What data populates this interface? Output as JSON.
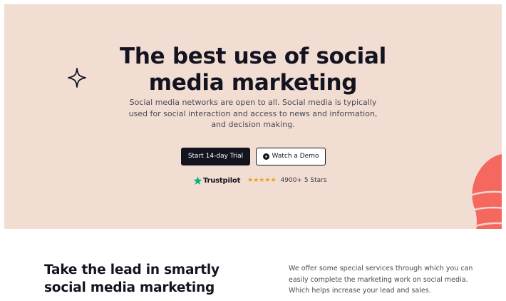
{
  "hero": {
    "title_lines": [
      "The best use of social",
      "media marketing"
    ],
    "description_lines": [
      "Social media networks are open to all. Social media is typically",
      "used for social interaction and access to news and information,",
      "and decision making."
    ],
    "primary_button": "Start 14-day Trial",
    "secondary_button": "Watch a Demo",
    "trustpilot_label": "Trustpilot",
    "stars": "★★★★★",
    "rating_text": "4900+ 5 Stars",
    "star_rating": 5
  },
  "lead": {
    "title_lines": [
      "Take the lead in smartly",
      "social media marketing"
    ],
    "description_lines": [
      "We offer some special services through which you can",
      "easily complete the marketing work on social media.",
      "Which helps increase your lead and sales."
    ]
  },
  "colors": {
    "hero_background": "#f2ddd3",
    "text_dark": "#141420",
    "star_orange": "#f0a020",
    "trustpilot_green": "#00b67a",
    "blob_coral": "#f4685f"
  },
  "icons": [
    "sparkle-icon",
    "play-circle-icon",
    "trustpilot-star-icon",
    "decorative-blob"
  ]
}
